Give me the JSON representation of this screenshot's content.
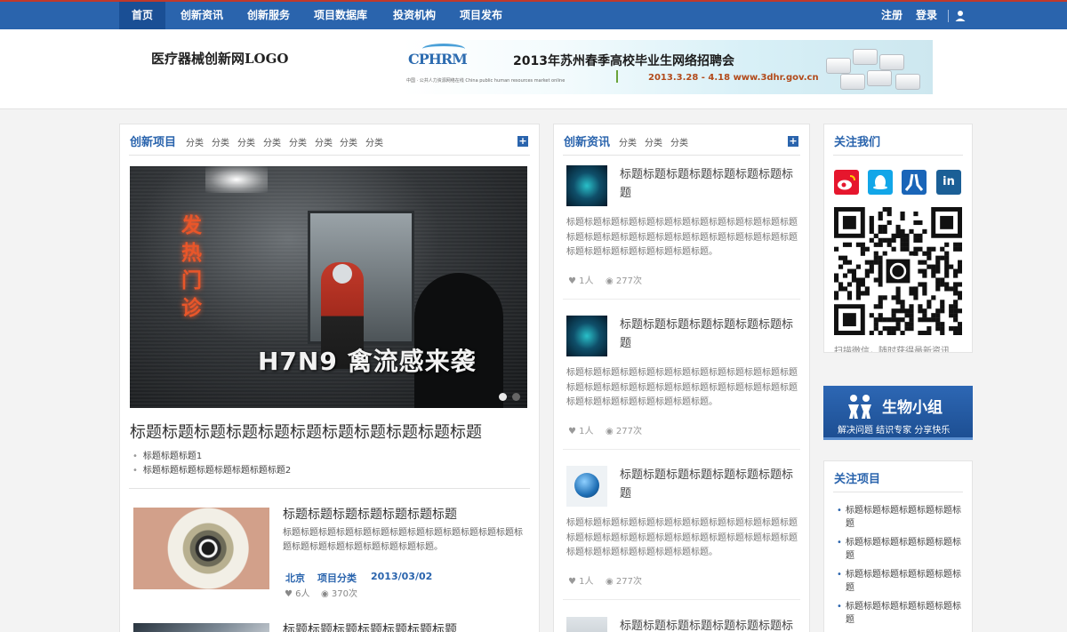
{
  "nav": {
    "items": [
      "首页",
      "创新资讯",
      "创新服务",
      "项目数据库",
      "投资机构",
      "项目发布"
    ],
    "register": "注册",
    "login": "登录",
    "user_icon": "user-icon"
  },
  "header": {
    "logo_text": "医疗器械创新网LOGO",
    "banner": {
      "brand": "CPHRM",
      "brand_sub": "中国 · 公共人力资源网络在线 China public human resources market online",
      "title": "2013年苏州春季高校毕业生网络招聘会",
      "dates": "2013.3.28 - 4.18 www.3dhr.gov.cn"
    }
  },
  "projects": {
    "title": "创新项目",
    "categories": [
      "分类",
      "分类",
      "分类",
      "分类",
      "分类",
      "分类",
      "分类",
      "分类"
    ],
    "slider_caption": "H7N9 禽流感来袭",
    "slider_sign": "发热门诊",
    "big_title": "标题标题标题标题标题标题标题标题标题标题标题",
    "sub_links": [
      "标题标题标题1",
      "标题标题标题标题标题标题标题标题2"
    ],
    "articles": [
      {
        "title": "标题标题标题标题标题标题标题",
        "desc": "标题标题标题标题标题标题标题标题标题标题标题标题标题标题标题标题标题标题标题标题标题标题。",
        "city": "北京",
        "category": "项目分类",
        "date": "2013/03/02",
        "likes": "6人",
        "views": "370次"
      },
      {
        "title": "标题标题标题标题标题标题标题"
      }
    ]
  },
  "news": {
    "title": "创新资讯",
    "categories": [
      "分类",
      "分类",
      "分类"
    ],
    "items": [
      {
        "title": "标题标题标题标题标题标题标题标题",
        "desc": "标题标题标题标题标题标题标题标题标题标题标题标题标题标题标题标题标题标题标题标题标题标题标题标题标题标题标题标题标题标题标题标题标题标题。",
        "likes": "1人",
        "views": "277次"
      },
      {
        "title": "标题标题标题标题标题标题标题标题",
        "desc": "标题标题标题标题标题标题标题标题标题标题标题标题标题标题标题标题标题标题标题标题标题标题标题标题标题标题标题标题标题标题标题标题标题标题。",
        "likes": "1人",
        "views": "277次"
      },
      {
        "title": "标题标题标题标题标题标题标题标题",
        "desc": "标题标题标题标题标题标题标题标题标题标题标题标题标题标题标题标题标题标题标题标题标题标题标题标题标题标题标题标题标题标题标题标题标题标题。",
        "likes": "1人",
        "views": "277次"
      },
      {
        "title": "标题标题标题标题标题标题标题标题"
      }
    ]
  },
  "follow_us": {
    "title": "关注我们",
    "icons": [
      "weibo-icon",
      "qq-icon",
      "renren-icon",
      "linkedin-icon"
    ],
    "linkedin_text": "in",
    "qr_caption": "扫描微信，随时获得最新资讯"
  },
  "bio_group": {
    "title": "生物小组",
    "subtitle": "解决问题  结识专家  分享快乐"
  },
  "follow_projects": {
    "title": "关注项目",
    "items": [
      "标题标题标题标题标题标题标题",
      "标题标题标题标题标题标题标题",
      "标题标题标题标题标题标题标题",
      "标题标题标题标题标题标题标题"
    ]
  },
  "colors": {
    "primary": "#2a64ad",
    "accent_red": "#c0392b"
  }
}
